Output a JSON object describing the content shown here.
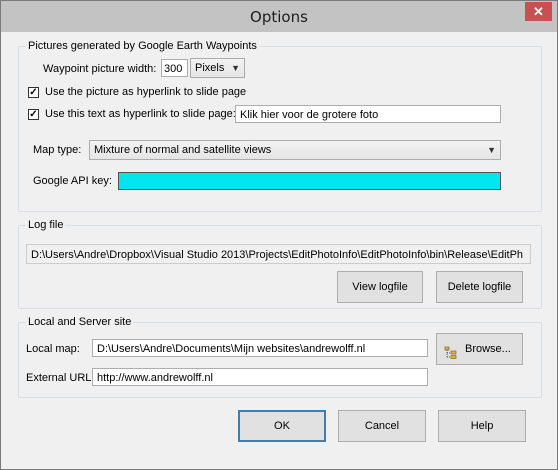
{
  "window": {
    "title": "Options",
    "close_glyph": "✕"
  },
  "pictures_group": {
    "legend": "Pictures generated by Google Earth Waypoints",
    "waypoint_width_label": "Waypoint picture width:",
    "waypoint_width_value": "300",
    "unit_value": "Pixels",
    "use_picture_hyperlink_label": "Use the picture as hyperlink to slide page",
    "use_picture_hyperlink_checked": true,
    "use_text_hyperlink_label": "Use this text as hyperlink to slide page:",
    "use_text_hyperlink_checked": true,
    "hyperlink_text_value": "Klik hier voor de grotere foto",
    "map_type_label": "Map type:",
    "map_type_value": "Mixture of normal and satellite views",
    "api_key_label": "Google API key:",
    "api_key_value": "",
    "api_key_background": "#00e5ee"
  },
  "log_group": {
    "legend": "Log file",
    "path_value": "D:\\Users\\Andre\\Dropbox\\Visual Studio 2013\\Projects\\EditPhotoInfo\\EditPhotoInfo\\bin\\Release\\EditPh",
    "view_button": "View logfile",
    "delete_button": "Delete logfile"
  },
  "site_group": {
    "legend": "Local and Server site",
    "local_map_label": "Local map:",
    "local_map_value": "D:\\Users\\Andre\\Documents\\Mijn websites\\andrewolff.nl",
    "browse_button": "Browse...",
    "browse_icon": "folder-tree-icon",
    "external_url_label": "External URL:",
    "external_url_value": "http://www.andrewolff.nl"
  },
  "buttons": {
    "ok": "OK",
    "cancel": "Cancel",
    "help": "Help"
  }
}
